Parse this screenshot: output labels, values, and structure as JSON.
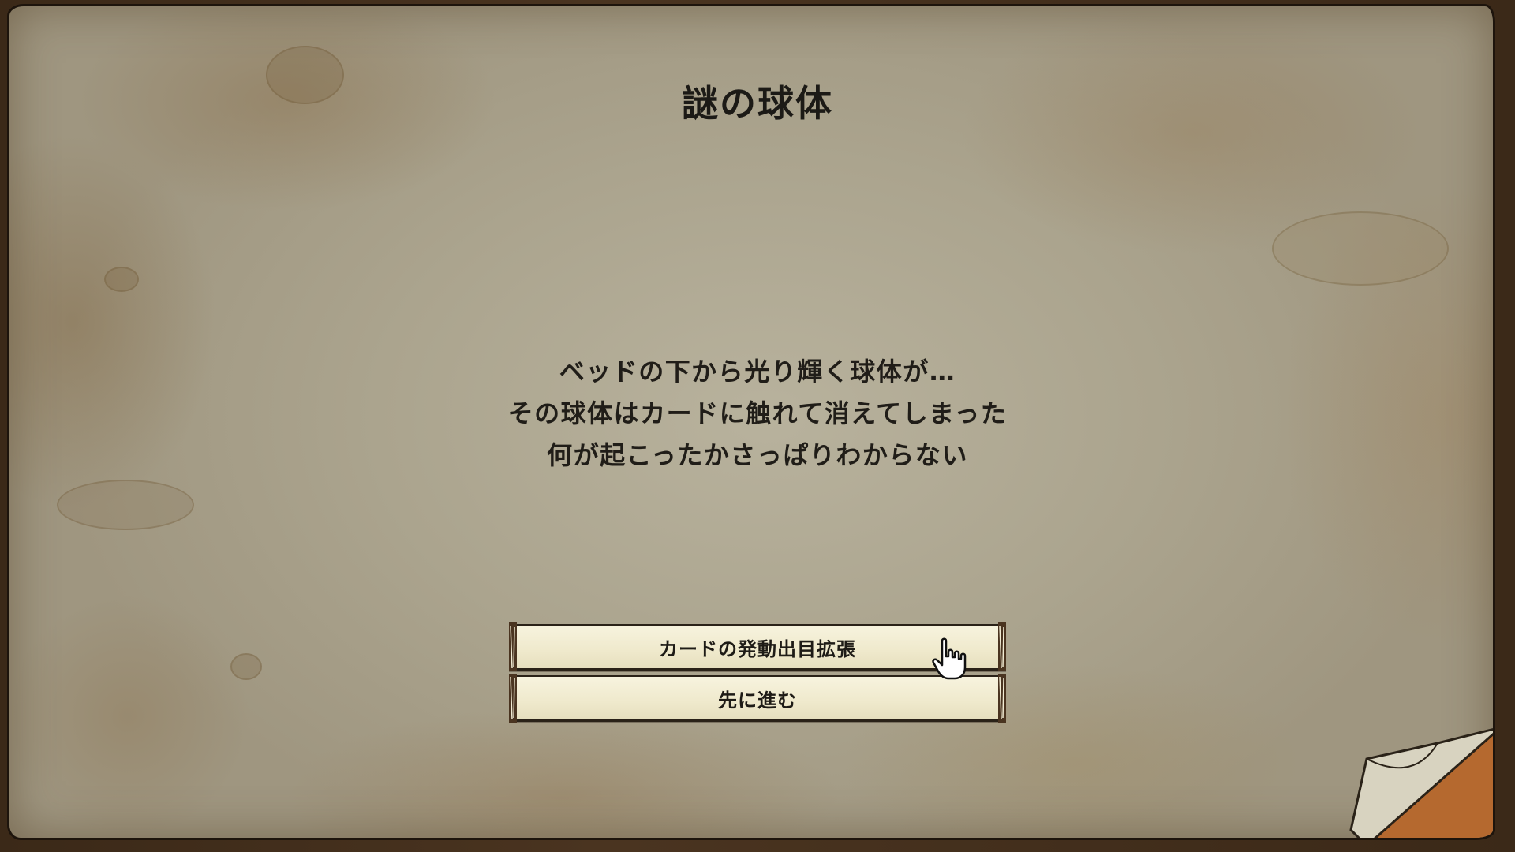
{
  "event": {
    "title": "謎の球体",
    "message_lines": [
      "ベッドの下から光り輝く球体が…",
      "その球体はカードに触れて消えてしまった",
      "何が起こったかさっぱりわからない"
    ]
  },
  "choices": [
    {
      "label": "カードの発動出目拡張"
    },
    {
      "label": "先に進む"
    }
  ],
  "icons": {
    "cursor": "pointing-hand-icon",
    "corner": "page-curl-icon"
  },
  "colors": {
    "parchment": "#aba48e",
    "button_fill": "#efe9cc",
    "text": "#1c1a16",
    "frame": "#3b2918"
  }
}
